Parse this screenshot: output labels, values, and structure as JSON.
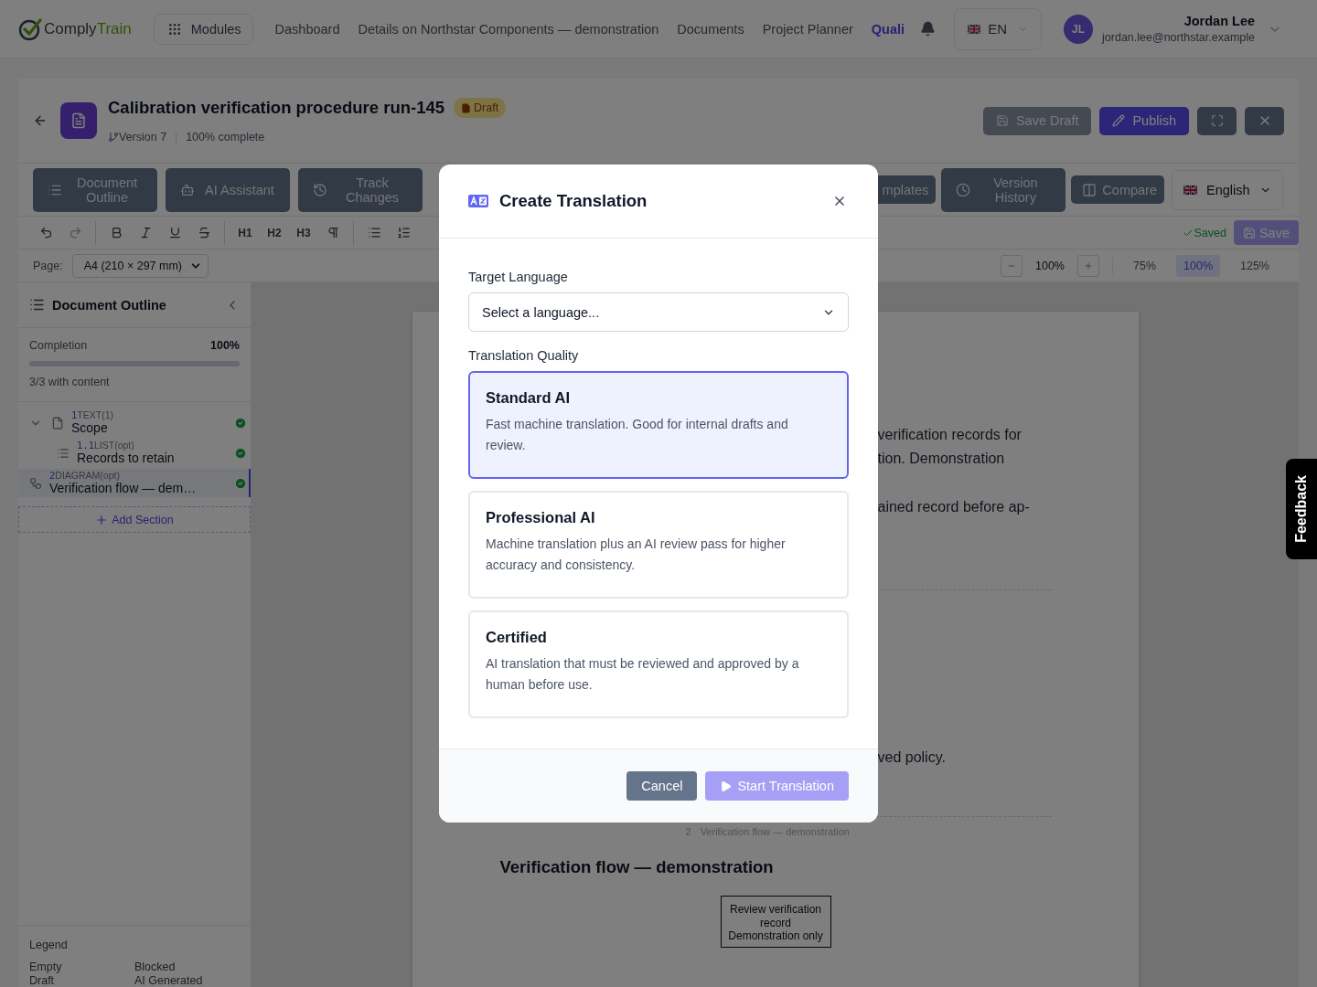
{
  "header": {
    "logo": {
      "prefix": "Comply",
      "suffix": "Train"
    },
    "modules": "Modules",
    "nav": [
      {
        "label": "Dashboard",
        "selected": false
      },
      {
        "label": "Details on Northstar Components — demonstration",
        "selected": false
      },
      {
        "label": "Documents",
        "selected": false
      },
      {
        "label": "Project Planner",
        "selected": false
      },
      {
        "label": "Quali",
        "selected": true
      }
    ],
    "language": "EN",
    "user": {
      "initials": "JL",
      "name": "Jordan Lee",
      "email": "jordan.lee@northstar.example"
    }
  },
  "document": {
    "title": "Calibration verification procedure run-145",
    "status": "Draft",
    "version": "Version 7",
    "progress": "100% complete",
    "actions": [
      {
        "kind": "save_draft",
        "label": "Save Draft",
        "disabled": true
      },
      {
        "kind": "publish",
        "label": "Publish",
        "disabled": false
      }
    ]
  },
  "toolbar": {
    "left": [
      {
        "kind": "outline",
        "label": "Document Outline"
      },
      {
        "kind": "assistant",
        "label": "AI Assistant"
      },
      {
        "kind": "changes",
        "label": "Track Changes"
      }
    ],
    "right": [
      {
        "kind": "templates",
        "label": "mplates"
      },
      {
        "kind": "history",
        "label": "Version History"
      },
      {
        "kind": "compare",
        "label": "Compare"
      }
    ],
    "language": "English"
  },
  "format": {
    "groups": [
      [
        {
          "kind": "undo",
          "disabled": false
        },
        {
          "kind": "redo",
          "disabled": true
        }
      ],
      [
        {
          "kind": "bold",
          "disabled": false
        },
        {
          "kind": "italic",
          "disabled": false
        },
        {
          "kind": "underline",
          "disabled": false
        },
        {
          "kind": "strike",
          "disabled": false
        }
      ],
      [
        {
          "kind": "text",
          "label": "H1",
          "disabled": false
        },
        {
          "kind": "text",
          "label": "H2",
          "disabled": false
        },
        {
          "kind": "text",
          "label": "H3",
          "disabled": false
        },
        {
          "kind": "pilcrow",
          "disabled": false
        }
      ],
      [
        {
          "kind": "bullets",
          "disabled": false
        },
        {
          "kind": "numbered",
          "disabled": false
        }
      ]
    ],
    "saved": "Saved",
    "save": {
      "label": "Save",
      "disabled": true
    }
  },
  "page_bar": {
    "label": "Page:",
    "size": "A4 (210 × 297 mm)",
    "zoom": "100%",
    "presets": [
      {
        "label": "75%",
        "selected": false
      },
      {
        "label": "100%",
        "selected": true
      },
      {
        "label": "125%",
        "selected": false
      }
    ]
  },
  "outline": {
    "title": "Document Outline",
    "completion_label": "Completion",
    "completion_value": "100%",
    "level": 1,
    "content_count": "3/3 with content",
    "sections": [
      {
        "number": "1",
        "type": "TEXT(1)",
        "name": "Scope",
        "kind": "text",
        "complete": true,
        "selected": false,
        "expanded": true,
        "children": [
          {
            "number": "1.1",
            "type": "LIST(opt)",
            "name": "Records to retain",
            "kind": "list",
            "complete": true,
            "selected": false
          }
        ]
      },
      {
        "number": "2",
        "type": "DIAGRAM(opt)",
        "name": "Verification flow — dem…",
        "kind": "diagram",
        "complete": true,
        "selected": true
      }
    ],
    "add_section": "Add Section",
    "legend": {
      "title": "Legend",
      "items": [
        "Empty",
        "Blocked",
        "Draft",
        "AI Generated"
      ]
    }
  },
  "paper": {
    "fragments": [
      "verification records for",
      "tion. Demonstration",
      "ained record before ap-",
      "ved policy."
    ],
    "toc_number": "2",
    "toc_title": "Verification flow — demonstration",
    "heading": "Verification flow — demonstration",
    "diagram_node": [
      "Review verification record",
      "Demonstration only"
    ]
  },
  "feedback": "Feedback",
  "modal": {
    "title": "Create Translation",
    "target_label": "Target Language",
    "target_placeholder": "Select a language...",
    "quality_label": "Translation Quality",
    "options": [
      {
        "title": "Standard AI",
        "description": "Fast machine translation. Good for internal drafts and review.",
        "selected": true
      },
      {
        "title": "Professional AI",
        "description": "Machine translation plus an AI review pass for higher accuracy and consistency.",
        "selected": false
      },
      {
        "title": "Certified",
        "description": "AI translation that must be reviewed and approved by a human before use.",
        "selected": false
      }
    ],
    "cancel": "Cancel",
    "start": {
      "label": "Start Translation",
      "disabled": true
    }
  }
}
